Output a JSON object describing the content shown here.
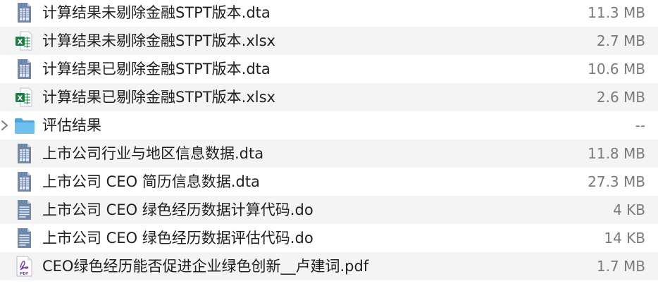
{
  "files": [
    {
      "name": "计算结果未剔除金融STPT版本.dta",
      "size": "11.3 MB",
      "icon": "dta-doc-icon"
    },
    {
      "name": "计算结果未剔除金融STPT版本.xlsx",
      "size": "2.7 MB",
      "icon": "excel-icon"
    },
    {
      "name": "计算结果已剔除金融STPT版本.dta",
      "size": "10.6 MB",
      "icon": "dta-doc-icon"
    },
    {
      "name": "计算结果已剔除金融STPT版本.xlsx",
      "size": "2.6 MB",
      "icon": "excel-icon"
    },
    {
      "name": "评估结果",
      "size": "--",
      "icon": "folder-icon"
    },
    {
      "name": "上市公司行业与地区信息数据.dta",
      "size": "11.8 MB",
      "icon": "dta-doc-icon"
    },
    {
      "name": "上市公司 CEO 简历信息数据.dta",
      "size": "27.3 MB",
      "icon": "dta-doc-icon"
    },
    {
      "name": "上市公司 CEO 绿色经历数据计算代码.do",
      "size": "4 KB",
      "icon": "do-doc-icon"
    },
    {
      "name": "上市公司 CEO 绿色经历数据评估代码.do",
      "size": "14 KB",
      "icon": "do-doc-icon"
    },
    {
      "name": "CEO绿色经历能否促进企业绿色创新__卢建词.pdf",
      "size": "1.7 MB",
      "icon": "pdf-icon"
    }
  ],
  "colors": {
    "row_alt": "#f4f4f5",
    "doc_blue": "#6f87a8",
    "excel_green": "#1f7a45",
    "folder_blue": "#5fb4ea",
    "pdf_purple": "#7a3fb0"
  }
}
